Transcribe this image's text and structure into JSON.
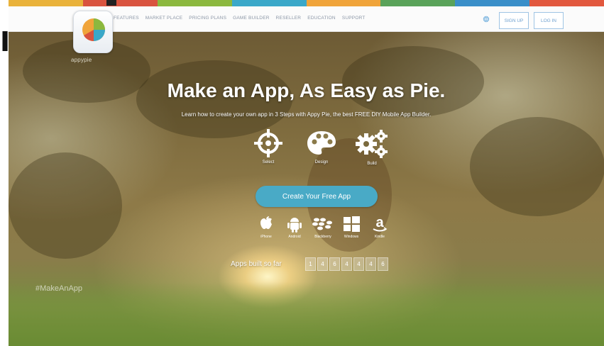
{
  "colors": {
    "brand_stripe": [
      "#e9b23a",
      "#d9533f",
      "#8bb83e",
      "#3aa8c9",
      "#f0a43a",
      "#5aa35a",
      "#3a8fc9",
      "#e2583e"
    ],
    "cta_background": "#49aac6",
    "nav_link": "#8b96a6",
    "outline_button": "#6fa0cf"
  },
  "header": {
    "logo_text": "appypie",
    "nav_items": [
      "FEATURES",
      "MARKET PLACE",
      "PRICING PLANS",
      "GAME BUILDER",
      "RESELLER",
      "EDUCATION",
      "SUPPORT"
    ],
    "globe_icon": "globe-icon",
    "signup_label": "SIGN UP",
    "login_label": "LOG IN"
  },
  "hero": {
    "headline": "Make an App, As Easy as Pie.",
    "subheadline": "Learn how to create your own app in 3 Steps with Appy Pie, the best FREE DIY Mobile App Builder.",
    "steps": [
      {
        "label": "Select",
        "icon": "target-icon"
      },
      {
        "label": "Design",
        "icon": "palette-icon"
      },
      {
        "label": "Build",
        "icon": "gears-icon"
      }
    ],
    "cta_label": "Create Your Free App",
    "platforms": [
      {
        "label": "iPhone",
        "icon": "apple-icon"
      },
      {
        "label": "Android",
        "icon": "android-icon"
      },
      {
        "label": "Blackberry",
        "icon": "blackberry-icon"
      },
      {
        "label": "Windows",
        "icon": "windows-icon"
      },
      {
        "label": "Kindle",
        "icon": "amazon-icon"
      }
    ],
    "counter_label": "Apps built so far",
    "counter_digits": [
      "1",
      "4",
      "6",
      "4",
      "4",
      "4",
      "6"
    ],
    "watermark": "#MakeAnApp"
  },
  "overlay": {
    "left_bracket": "I"
  }
}
